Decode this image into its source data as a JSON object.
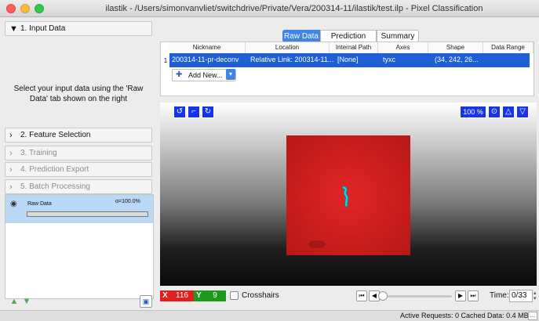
{
  "window": {
    "title": "ilastik - /Users/simonvanvliet/switchdrive/Private/Vera/200314-11/ilastik/test.ilp - Pixel Classification"
  },
  "applets": [
    {
      "label": "1. Input Data",
      "chevron": "▼",
      "state": "active"
    },
    {
      "label": "2. Feature Selection",
      "chevron": "›",
      "state": "active"
    },
    {
      "label": "3. Training",
      "chevron": "›",
      "state": "dim"
    },
    {
      "label": "4. Prediction Export",
      "chevron": "›",
      "state": "dim"
    },
    {
      "label": "5. Batch Processing",
      "chevron": "›",
      "state": "dim"
    }
  ],
  "input_help": "Select your input data using the 'Raw Data' tab shown on the right",
  "layer": {
    "name": "Raw Data",
    "opacity": "α=100.0%",
    "visible_icon": "eye-icon"
  },
  "tabs": [
    "Raw Data",
    "Prediction Mask",
    "Summary"
  ],
  "table": {
    "columns": [
      "Nickname",
      "Location",
      "Internal Path",
      "Axes",
      "Shape",
      "Data Range"
    ],
    "rows": [
      {
        "num": "1",
        "nickname": "200314-11-pr-deconv",
        "location": "Relative Link: 200314-11...",
        "internal_path": "[None]",
        "axes": "tyxc",
        "shape": "(34, 242, 26...",
        "data_range": ""
      }
    ],
    "add_new": "Add New..."
  },
  "viewer": {
    "zoom": "100 %",
    "colors": {
      "button_blue": "#1834e8",
      "image_red": "#d22222",
      "cell_cyan": "#22d0c8"
    }
  },
  "coords": {
    "x_label": "X",
    "x_value": "116",
    "y_label": "Y",
    "y_value": "9",
    "x_color": "#e02020",
    "y_color": "#1d9a1d"
  },
  "crosshairs": "Crosshairs",
  "time": {
    "label": "Time:",
    "value": "0/33"
  },
  "status": "Active Requests: 0  Cached Data: 0.4 MB"
}
